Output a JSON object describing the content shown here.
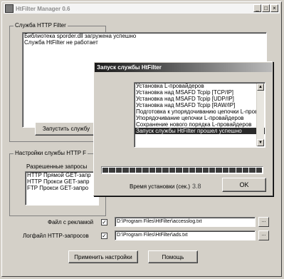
{
  "window": {
    "title": "HtFilter Manager 0.6",
    "controls": {
      "minimize": "_",
      "maximize": "□",
      "close": "×"
    }
  },
  "http_filter_group": {
    "legend": "Служба HTTP Filter",
    "log_lines": [
      "Библиотека sporder.dll загружена успешно",
      "Служба HtFilter не работает"
    ],
    "start_button": "Запустить службу"
  },
  "settings_group": {
    "legend": "Настройки службы HTTP F",
    "allowed_label": "Разрешенные запросы",
    "allowed_items": [
      "HTTP Прямой GET-запр",
      "HTTP Прокси GET-запр",
      "FTP Прокси GET-запро"
    ]
  },
  "files": {
    "ads_label": "Файл с рекламой",
    "ads_checked": "✓",
    "ads_path": "D:\\Program Files\\HtFilter\\accesslog.txt",
    "log_label": "Логфайл HTTP-запросов",
    "log_checked": "✓",
    "log_path": "D:\\Program Files\\HtFilter\\ads.txt",
    "browse": "..."
  },
  "buttons": {
    "apply": "Применить настройки",
    "help": "Помощь"
  },
  "dialog": {
    "title": "Запуск службы HtFilter",
    "steps": [
      "Установка L-провайдеров",
      "Установка над MSAFD Tcpip [TCP/IP]",
      "Установка над MSAFD Tcpip [UDP/IP]",
      "Установка над MSAFD Tcpip [RAW/IP]",
      "Подготовка к упорядочиванию цепочки L-провай",
      "Упорядочивание цепочки L-провайдеров",
      "Сохранение нового порядка L-провайдеров",
      "Запуск службы HtFilter прошел успешно"
    ],
    "selected_step": "Запуск службы HtFilter прошел успешно",
    "progress": 1.0,
    "time_label": "Время установки (сек.)",
    "time_value": "3.8",
    "ok": "OK"
  }
}
